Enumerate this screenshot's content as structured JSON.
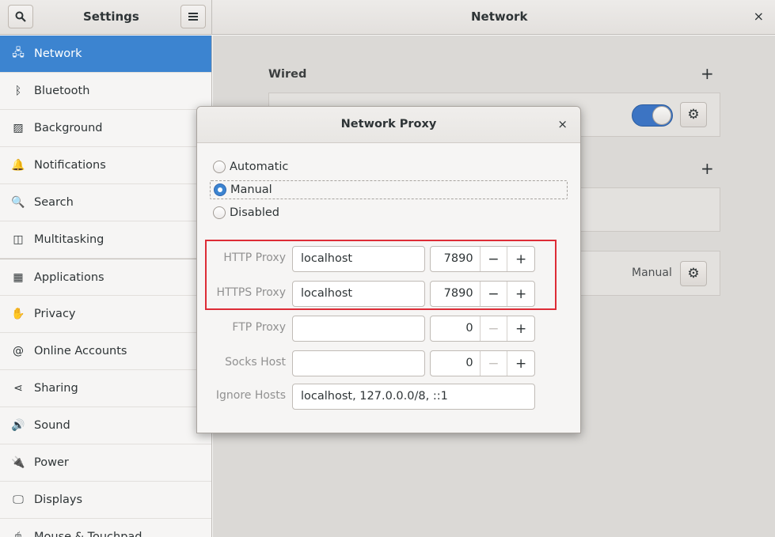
{
  "header": {
    "sidebar_title": "Settings",
    "panel_title": "Network",
    "close_glyph": "×"
  },
  "sidebar": {
    "items": [
      {
        "label": "Network",
        "icon": "network-icon",
        "glyph": "🖧",
        "active": true
      },
      {
        "label": "Bluetooth",
        "icon": "bluetooth-icon",
        "glyph": "ᛒ"
      },
      {
        "label": "Background",
        "icon": "background-icon",
        "glyph": "▨"
      },
      {
        "label": "Notifications",
        "icon": "bell-icon",
        "glyph": "🔔"
      },
      {
        "label": "Search",
        "icon": "search-icon",
        "glyph": "🔍"
      },
      {
        "label": "Multitasking",
        "icon": "multitasking-icon",
        "glyph": "◫"
      },
      {
        "label": "Applications",
        "icon": "apps-icon",
        "glyph": "▦",
        "chevron": true
      },
      {
        "label": "Privacy",
        "icon": "hand-icon",
        "glyph": "✋",
        "chevron": true
      },
      {
        "label": "Online Accounts",
        "icon": "at-icon",
        "glyph": "@"
      },
      {
        "label": "Sharing",
        "icon": "share-icon",
        "glyph": "⋖"
      },
      {
        "label": "Sound",
        "icon": "speaker-icon",
        "glyph": "🔊"
      },
      {
        "label": "Power",
        "icon": "power-icon",
        "glyph": "🔌"
      },
      {
        "label": "Displays",
        "icon": "display-icon",
        "glyph": "🖵"
      },
      {
        "label": "Mouse & Touchpad",
        "icon": "mouse-icon",
        "glyph": "🖱"
      }
    ]
  },
  "main": {
    "wired_title": "Wired",
    "add_glyph": "+",
    "proxy_mode_label": "Manual",
    "wired_switch_on": true
  },
  "dialog": {
    "title": "Network Proxy",
    "close_glyph": "×",
    "modes": [
      "Automatic",
      "Manual",
      "Disabled"
    ],
    "selected_mode": "Manual",
    "rows": [
      {
        "label": "HTTP Proxy",
        "host": "localhost",
        "port": "7890"
      },
      {
        "label": "HTTPS Proxy",
        "host": "localhost",
        "port": "7890"
      },
      {
        "label": "FTP Proxy",
        "host": "",
        "port": "0"
      },
      {
        "label": "Socks Host",
        "host": "",
        "port": "0"
      }
    ],
    "ignore_label": "Ignore Hosts",
    "ignore_value": "localhost, 127.0.0.0/8, ::1",
    "minus_glyph": "−",
    "plus_glyph": "+"
  },
  "colors": {
    "accent": "#3c84d0",
    "highlight": "#dd2c36"
  }
}
